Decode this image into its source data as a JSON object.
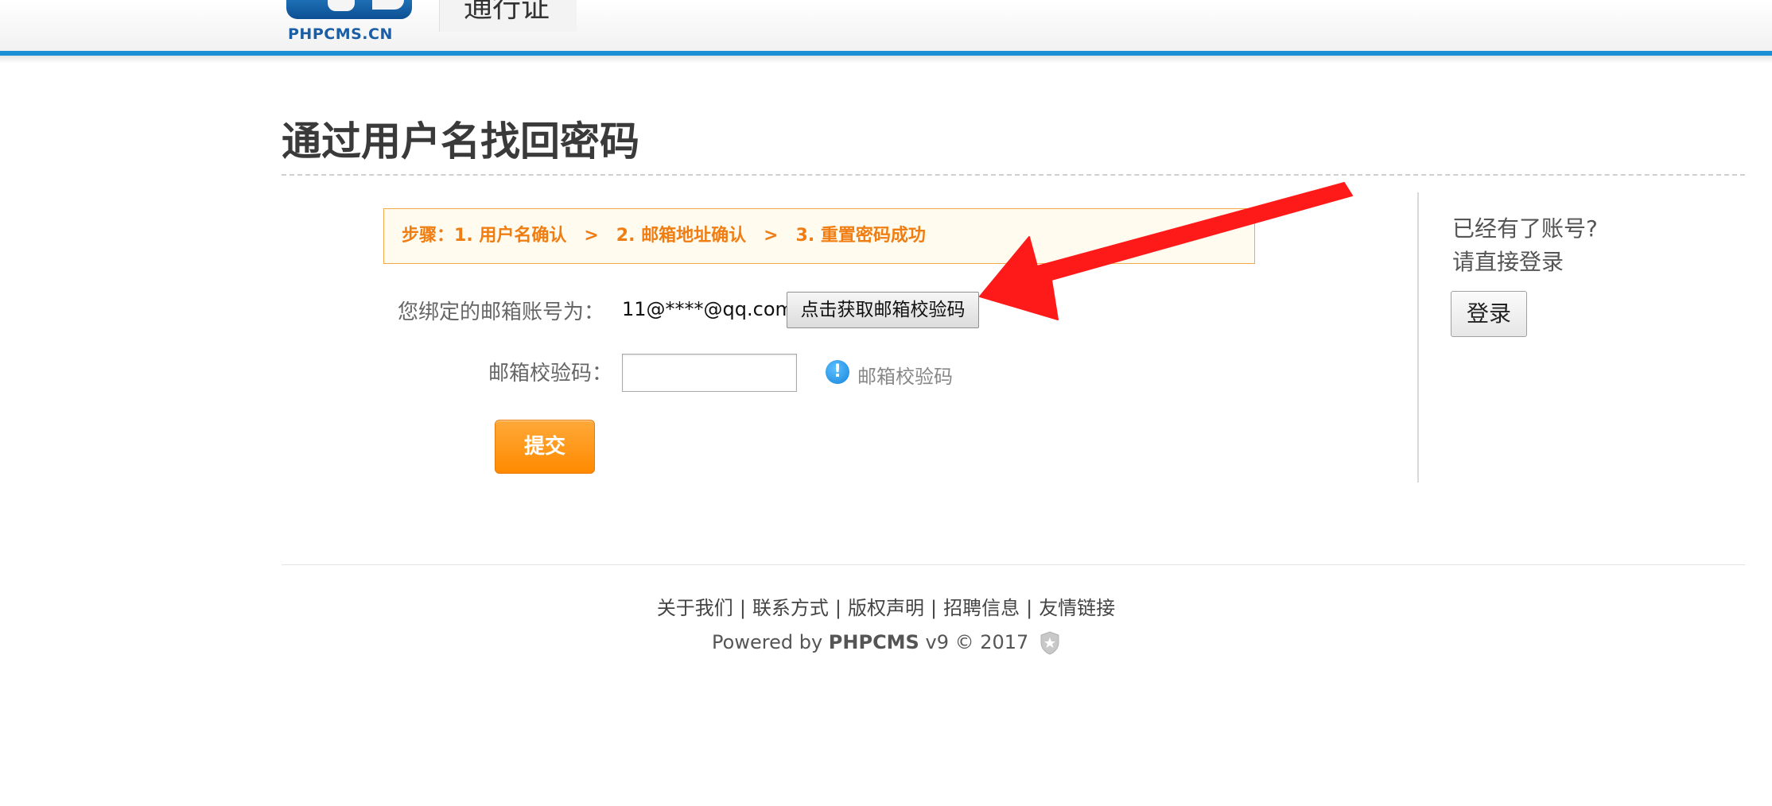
{
  "header": {
    "logo_text": "PHPCMS.CN",
    "tab_text": "通行证"
  },
  "main": {
    "title": "通过用户名找回密码",
    "steps": {
      "prefix": "步骤：",
      "step1": "1. 用户名确认",
      "step2": "2. 邮箱地址确认",
      "step3": "3. 重置密码成功",
      "separator": ">"
    },
    "email_row": {
      "label": "您绑定的邮箱账号为：",
      "value": "11@****@qq.com",
      "button_label": "点击获取邮箱校验码"
    },
    "code_row": {
      "label": "邮箱校验码：",
      "input_value": "",
      "hint_icon": "info-icon",
      "hint": "邮箱校验码"
    },
    "submit_label": "提交"
  },
  "sidebar": {
    "line1": "已经有了账号?",
    "line2": "请直接登录",
    "login_label": "登录"
  },
  "footer": {
    "links": [
      "关于我们",
      "联系方式",
      "版权声明",
      "招聘信息",
      "友情链接"
    ],
    "separator": "|",
    "powered_prefix": "Powered by",
    "powered_brand": "PHPCMS",
    "powered_suffix": "v9 © 2017"
  },
  "colors": {
    "accent_blue": "#1a8fd6",
    "step_orange": "#f07d12",
    "submit_orange": "#ff8a00",
    "annotation_red": "#ff1a1a"
  }
}
